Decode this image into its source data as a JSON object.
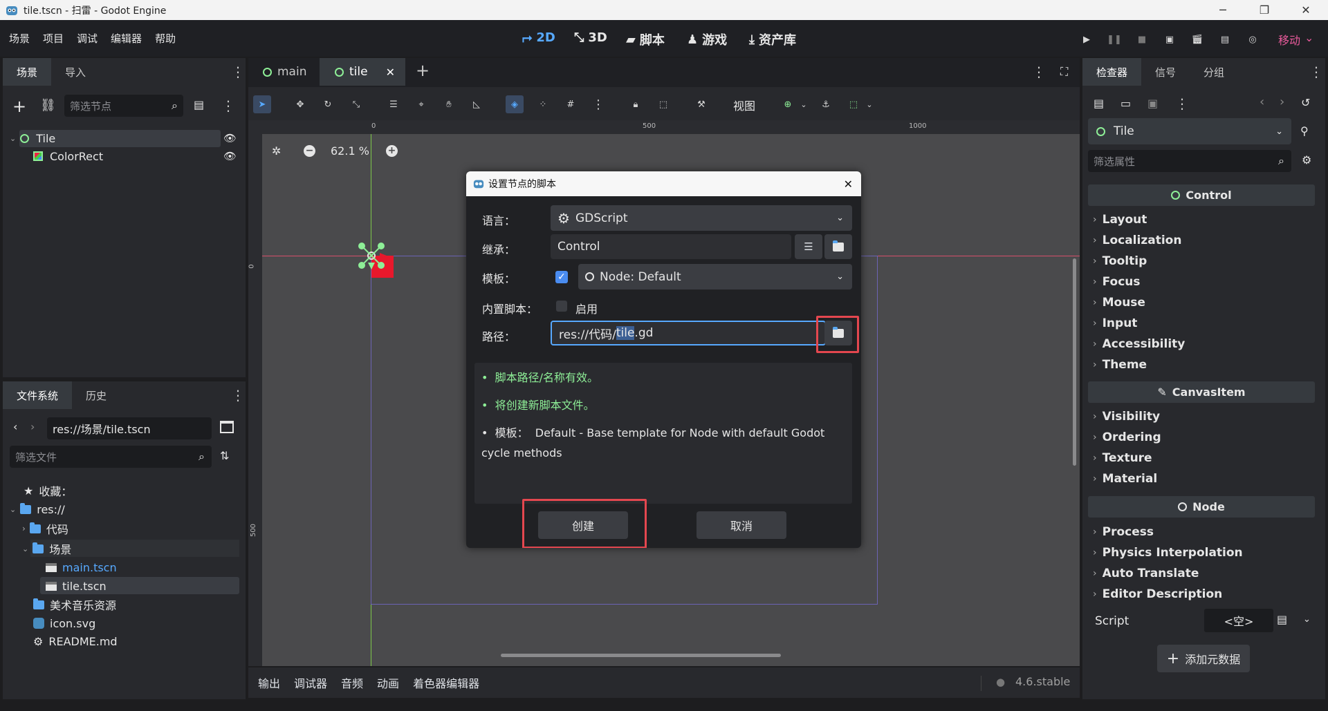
{
  "window": {
    "title": "tile.tscn - 扫雷 - Godot Engine",
    "min": "─",
    "max": "❐",
    "close": "✕"
  },
  "menus": [
    "场景",
    "项目",
    "调试",
    "编辑器",
    "帮助"
  ],
  "main_tabs": [
    {
      "label": "2D",
      "icon": "2d-icon",
      "active": true
    },
    {
      "label": "3D",
      "icon": "3d-icon"
    },
    {
      "label": "脚本",
      "icon": "script-icon"
    },
    {
      "label": "游戏",
      "icon": "game-icon"
    },
    {
      "label": "资产库",
      "icon": "assetlib-icon"
    }
  ],
  "renderer": "移动",
  "scene_dock": {
    "tabs": [
      "场景",
      "导入"
    ],
    "filter_placeholder": "筛选节点",
    "nodes": [
      {
        "name": "Tile",
        "icon": "control-icon"
      },
      {
        "name": "ColorRect",
        "icon": "colorrect-icon"
      }
    ]
  },
  "editor_tabs": [
    {
      "label": "main"
    },
    {
      "label": "tile",
      "active": true
    }
  ],
  "toolbar": {
    "view_label": "视图"
  },
  "viewport": {
    "zoom": "62.1 %",
    "ruler_marks": [
      "0",
      "500",
      "1000"
    ],
    "ruler_left_marks": [
      "0",
      "500"
    ]
  },
  "filesystem": {
    "tabs": [
      "文件系统",
      "历史"
    ],
    "path": "res://场景/tile.tscn",
    "filter_placeholder": "筛选文件",
    "favorites": "收藏：",
    "items": [
      "res://",
      "代码",
      "场景",
      "main.tscn",
      "tile.tscn",
      "美术音乐资源",
      "icon.svg",
      "README.md"
    ]
  },
  "inspector": {
    "tabs": [
      "检查器",
      "信号",
      "分组"
    ],
    "node": "Tile",
    "filter_placeholder": "筛选属性",
    "sections": [
      {
        "title": "Control",
        "groups": [
          "Layout",
          "Localization",
          "Tooltip",
          "Focus",
          "Mouse",
          "Input",
          "Accessibility",
          "Theme"
        ]
      },
      {
        "title": "CanvasItem",
        "groups": [
          "Visibility",
          "Ordering",
          "Texture",
          "Material"
        ]
      },
      {
        "title": "Node",
        "groups": [
          "Process",
          "Physics Interpolation",
          "Auto Translate",
          "Editor Description"
        ]
      }
    ],
    "script_label": "Script",
    "script_value": "<空>",
    "add_metadata": "添加元数据"
  },
  "dialog": {
    "title": "设置节点的脚本",
    "language_label": "语言：",
    "language": "GDScript",
    "inherits_label": "继承：",
    "inherits": "Control",
    "template_label": "模板：",
    "template": "Node: Default",
    "builtin_label": "内置脚本：",
    "builtin_toggle": "启用",
    "path_label": "路径：",
    "path_before": "res://代码/",
    "path_selected": "tile",
    "path_after": ".gd",
    "messages": [
      "脚本路径/名称有效。",
      "将创建新脚本文件。"
    ],
    "template_prefix": "模板：",
    "template_desc_line1": "Default - Base template for Node with default Godot",
    "template_desc_line2": "cycle methods",
    "create": "创建",
    "cancel": "取消"
  },
  "bottom_panel": {
    "tabs": [
      "输出",
      "调试器",
      "音频",
      "动画",
      "着色器编辑器"
    ],
    "version": "4.6.stable"
  },
  "colors": {
    "accent": "#57a9ff",
    "green": "#8eef97",
    "highlight": "#e4474f",
    "renderer": "#e85a9b"
  }
}
